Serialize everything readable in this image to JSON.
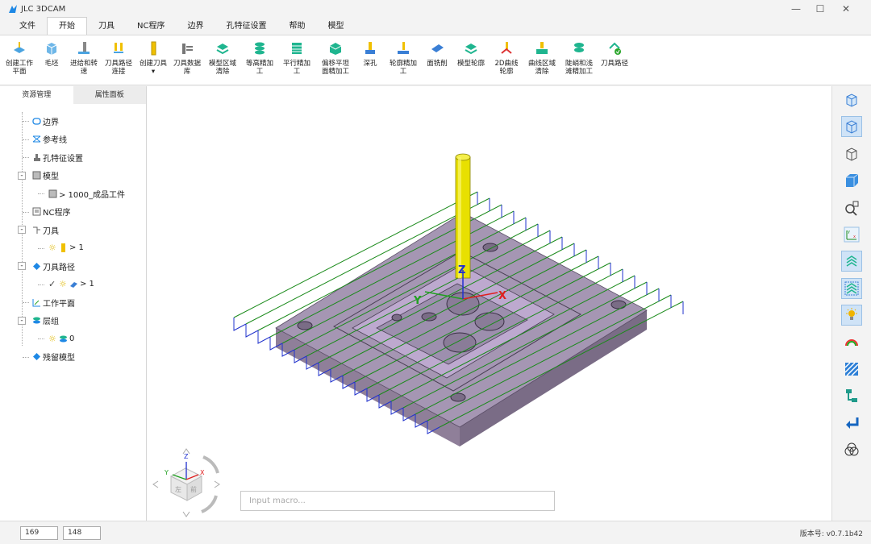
{
  "app": {
    "title": "JLC 3DCAM"
  },
  "window_controls": {
    "minimize": "—",
    "maximize": "☐",
    "close": "✕"
  },
  "menu": [
    "文件",
    "开始",
    "刀具",
    "NC程序",
    "边界",
    "孔特征设置",
    "帮助",
    "模型"
  ],
  "menu_active": "开始",
  "ribbon": [
    {
      "label": "创建工作\n平面",
      "icon": "workplane-icon"
    },
    {
      "label": "毛坯",
      "icon": "stock-icon"
    },
    {
      "label": "进给和转\n速",
      "icon": "feed-speed-icon"
    },
    {
      "label": "刀具路径\n连接",
      "icon": "toolpath-link-icon"
    },
    {
      "label": "创建刀具\n▾",
      "icon": "create-tool-icon"
    },
    {
      "label": "刀具数据\n库",
      "icon": "tool-database-icon"
    },
    {
      "label": "模型区域\n清除",
      "icon": "model-area-clear-icon"
    },
    {
      "label": "等高精加\n工",
      "icon": "constant-z-finish-icon"
    },
    {
      "label": "平行精加\n工",
      "icon": "parallel-finish-icon"
    },
    {
      "label": "偏移平坦\n面精加工",
      "icon": "offset-flat-finish-icon"
    },
    {
      "label": "深孔",
      "icon": "deep-hole-icon"
    },
    {
      "label": "轮廓精加\n工",
      "icon": "profile-finish-icon"
    },
    {
      "label": "面铣削",
      "icon": "face-mill-icon"
    },
    {
      "label": "模型轮廓",
      "icon": "model-profile-icon"
    },
    {
      "label": "2D曲线\n轮廓",
      "icon": "curve-2d-profile-icon"
    },
    {
      "label": "曲线区域\n清除",
      "icon": "curve-area-clear-icon"
    },
    {
      "label": "陡峭和浅\n滩精加工",
      "icon": "steep-shallow-finish-icon"
    },
    {
      "label": "刀具路径",
      "icon": "toolpath-icon"
    }
  ],
  "panel_tabs": [
    "资源管理",
    "属性面板"
  ],
  "tree": [
    {
      "label": "边界",
      "icon": "boundary-icon",
      "level": 0
    },
    {
      "label": "参考线",
      "icon": "reference-line-icon",
      "level": 0
    },
    {
      "label": "孔特征设置",
      "icon": "hole-feature-icon",
      "level": 0
    },
    {
      "label": "模型",
      "icon": "model-icon",
      "level": 0,
      "expander": "-"
    },
    {
      "label": "> 1000_成品工件",
      "icon": "model-item-icon",
      "level": 1
    },
    {
      "label": "NC程序",
      "icon": "nc-program-icon",
      "level": 0
    },
    {
      "label": "刀具",
      "icon": "tool-icon",
      "level": 0,
      "expander": "-"
    },
    {
      "label": "> 1",
      "icon": "tool-item-icon",
      "level": 1
    },
    {
      "label": "刀具路径",
      "icon": "toolpath-tree-icon",
      "level": 0,
      "expander": "-"
    },
    {
      "label": "> 1",
      "icon": "toolpath-item-icon",
      "level": 1
    },
    {
      "label": "工作平面",
      "icon": "workplane-tree-icon",
      "level": 0
    },
    {
      "label": "层组",
      "icon": "layer-group-icon",
      "level": 0,
      "expander": "-"
    },
    {
      "label": "0",
      "icon": "layer-item-icon",
      "level": 1
    },
    {
      "label": "残留模型",
      "icon": "rest-model-icon",
      "level": 0
    }
  ],
  "axes": {
    "x": "X",
    "y": "Y",
    "z": "Z"
  },
  "view_cube": {
    "left": "左",
    "front": "前"
  },
  "macro": {
    "placeholder": "Input macro..."
  },
  "status": {
    "coord1": "169",
    "coord2": "148",
    "version": "版本号: v0.7.1b42"
  },
  "colors": {
    "accent": "#1e88e5",
    "tool": "#e8e000",
    "model": "#a99bb8",
    "toolpath_green": "#1a8a1a",
    "toolpath_blue": "#2233cc"
  }
}
